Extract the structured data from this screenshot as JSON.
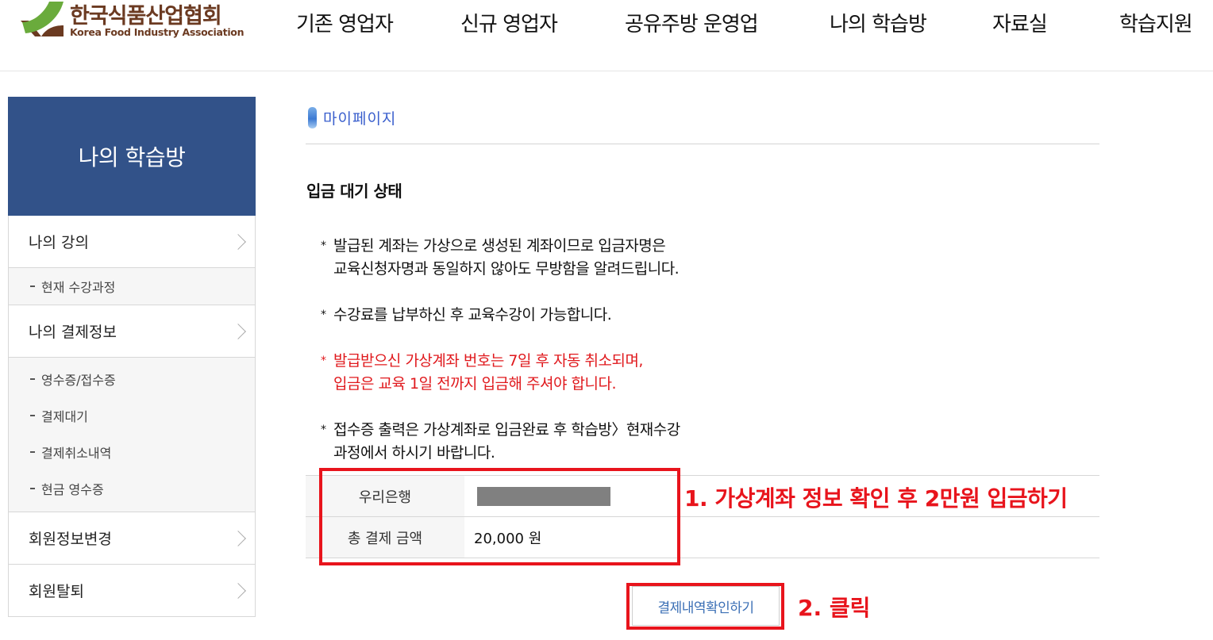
{
  "header": {
    "logo": {
      "name_ko": "한국식품산업협회",
      "name_en": "Korea Food Industry Association",
      "colors": {
        "green": "#6aab3c",
        "brown": "#6b3a21"
      }
    },
    "nav": [
      {
        "label": "기존 영업자"
      },
      {
        "label": "신규 영업자"
      },
      {
        "label": "공유주방 운영업"
      },
      {
        "label": "나의 학습방"
      },
      {
        "label": "자료실"
      },
      {
        "label": "학습지원"
      }
    ]
  },
  "sidebar": {
    "title": "나의 학습방",
    "accent": "#325289",
    "sections": [
      {
        "label": "나의 강의",
        "icon": "chevron-right-icon",
        "subitems": [
          {
            "label": "현재 수강과정"
          }
        ]
      },
      {
        "label": "나의 결제정보",
        "icon": "chevron-right-icon",
        "subitems": [
          {
            "label": "영수증/접수증"
          },
          {
            "label": "결제대기"
          },
          {
            "label": "결제취소내역"
          },
          {
            "label": "현금 영수증"
          }
        ]
      },
      {
        "label": "회원정보변경",
        "icon": "chevron-right-icon",
        "subitems": []
      },
      {
        "label": "회원탈퇴",
        "icon": "chevron-right-icon",
        "subitems": []
      }
    ]
  },
  "main": {
    "breadcrumb": {
      "icon": "pill-bullet-icon",
      "label": "마이페이지"
    },
    "title": "입금 대기 상태",
    "notes": [
      {
        "star": "*",
        "lines": [
          "발급된 계좌는 가상으로 생성된 계좌이므로 입금자명은",
          "교육신청자명과 동일하지 않아도 무방함을 알려드립니다."
        ],
        "color": "#111111"
      },
      {
        "star": "*",
        "lines": [
          "수강료를 납부하신 후 교육수강이 가능합니다."
        ],
        "color": "#111111"
      },
      {
        "star": "*",
        "lines": [
          "발급받으신 가상계좌 번호는 7일 후 자동 취소되며,",
          "입금은 교육 1일 전까지 입금해 주셔야 합니다."
        ],
        "color": "#e0191d"
      },
      {
        "star": "*",
        "lines": [
          "접수증 출력은 가상계좌로 입금완료 후 학습방〉현재수강",
          "과정에서 하시기 바랍니다."
        ],
        "color": "#111111"
      }
    ],
    "payment_table": {
      "rows": [
        {
          "label": "우리은행",
          "value": "(masked account number)"
        },
        {
          "label": "총 결제 금액",
          "value": "20,000 원"
        }
      ]
    },
    "confirm_button": {
      "label": "결제내역확인하기"
    }
  },
  "annotations": {
    "step1": "1. 가상계좌 정보 확인 후 2만원 입금하기",
    "step2": "2. 클릭",
    "color": "#e8141c"
  }
}
